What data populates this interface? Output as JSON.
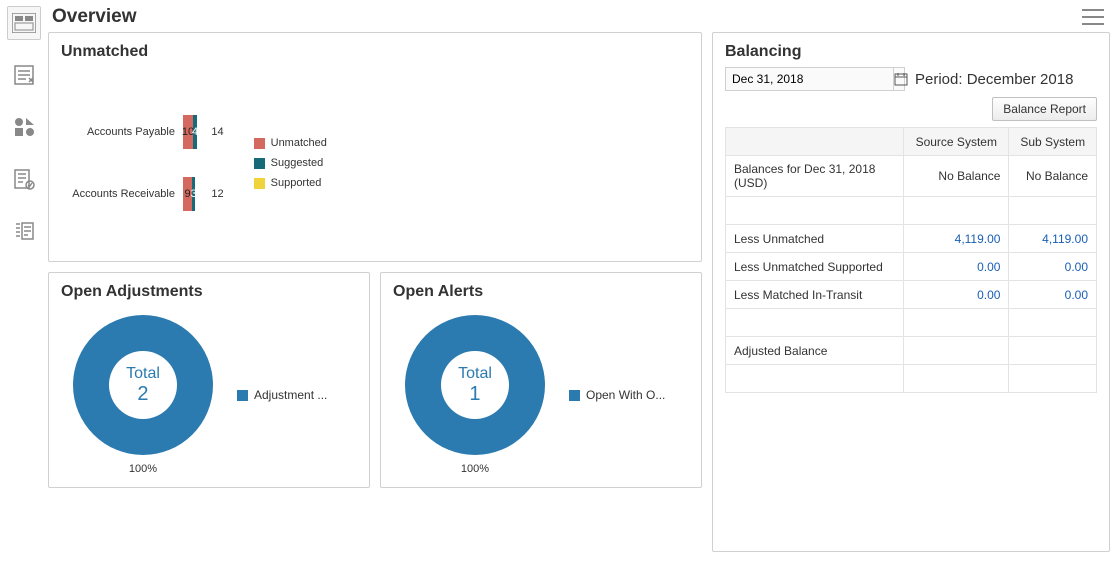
{
  "header": {
    "title": "Overview"
  },
  "sidebar": {
    "items": [
      {
        "name": "dashboard-icon"
      },
      {
        "name": "transactions-icon"
      },
      {
        "name": "shapes-icon"
      },
      {
        "name": "approvals-icon"
      },
      {
        "name": "reports-icon"
      }
    ]
  },
  "unmatched": {
    "title": "Unmatched",
    "legend": {
      "unmatched": "Unmatched",
      "suggested": "Suggested",
      "supported": "Supported"
    }
  },
  "chart_data": {
    "type": "bar",
    "orientation": "horizontal",
    "stacked": true,
    "categories": [
      "Accounts Payable",
      "Accounts Receivable"
    ],
    "series": [
      {
        "name": "Unmatched",
        "color": "#d46a5f",
        "values": [
          10,
          9
        ]
      },
      {
        "name": "Suggested",
        "color": "#176a77",
        "values": [
          4,
          3
        ]
      },
      {
        "name": "Supported",
        "color": "#f0d33a",
        "values": [
          0,
          0
        ]
      }
    ],
    "totals": [
      14,
      12
    ],
    "xlim": [
      0,
      15
    ],
    "title": "Unmatched"
  },
  "open_adjustments": {
    "title": "Open Adjustments",
    "center_label": "Total",
    "center_value": "2",
    "pct": "100%",
    "legend": "Adjustment ..."
  },
  "open_alerts": {
    "title": "Open Alerts",
    "center_label": "Total",
    "center_value": "1",
    "pct": "100%",
    "legend": "Open With O..."
  },
  "balancing": {
    "title": "Balancing",
    "date_value": "Dec 31, 2018",
    "period_label": "Period: December 2018",
    "button_label": "Balance Report",
    "columns": {
      "source": "Source System",
      "sub": "Sub System"
    },
    "rows": {
      "balances_label": "Balances for Dec 31, 2018 (USD)",
      "balances_source": "No Balance",
      "balances_sub": "No Balance",
      "less_unmatched_label": "Less Unmatched",
      "less_unmatched_source": "4,119.00",
      "less_unmatched_sub": "4,119.00",
      "less_unmatched_supported_label": "Less Unmatched Supported",
      "less_unmatched_supported_source": "0.00",
      "less_unmatched_supported_sub": "0.00",
      "less_matched_intransit_label": "Less Matched In-Transit",
      "less_matched_intransit_source": "0.00",
      "less_matched_intransit_sub": "0.00",
      "adjusted_balance_label": "Adjusted Balance"
    }
  }
}
